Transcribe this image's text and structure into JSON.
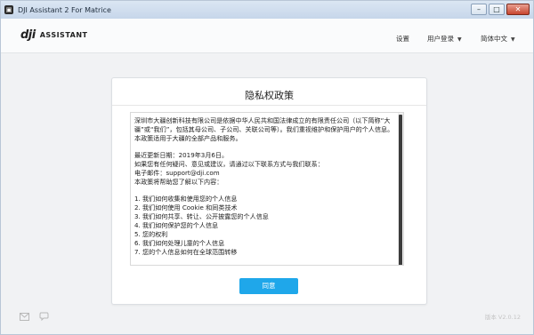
{
  "window": {
    "title": "DJI Assistant 2 For Matrice"
  },
  "header": {
    "logo_brand": "dji",
    "logo_text": "ASSISTANT",
    "nav": [
      {
        "label": "设置",
        "has_dropdown": false
      },
      {
        "label": "用户登录",
        "has_dropdown": true
      },
      {
        "label": "简体中文",
        "has_dropdown": true
      }
    ]
  },
  "dialog": {
    "title": "隐私权政策",
    "paragraphs": [
      "深圳市大疆创新科技有限公司是依据中华人民共和国法律成立的有限责任公司（以下简称“大疆”或“我们”，包括其母公司、子公司、关联公司等）。我们重视维护和保护用户的个人信息。本政策适用于大疆的全部产品和服务。",
      "最近更新日期：2019年3月6日。",
      "如果您有任何疑问、意见或建议，请通过以下联系方式与我们联系：",
      "电子邮件：support@dji.com",
      "本政策将帮助您了解以下内容："
    ],
    "list_items": [
      "1.  我们如何收集和使用您的个人信息",
      "2.  我们如何使用 Cookie 和同类技术",
      "3.  我们如何共享、转让、公开披露您的个人信息",
      "4.  我们如何保护您的个人信息",
      "5.  您的权利",
      "6.  我们如何处理儿童的个人信息",
      "7.  您的个人信息如何在全球范围转移"
    ],
    "agree_label": "同意"
  },
  "footer": {
    "version": "版本 V2.0.12",
    "icons": [
      "mail-icon",
      "feedback-icon"
    ]
  },
  "colors": {
    "accent": "#1fa7ea",
    "scroll_thumb": "#3c3c3c"
  }
}
